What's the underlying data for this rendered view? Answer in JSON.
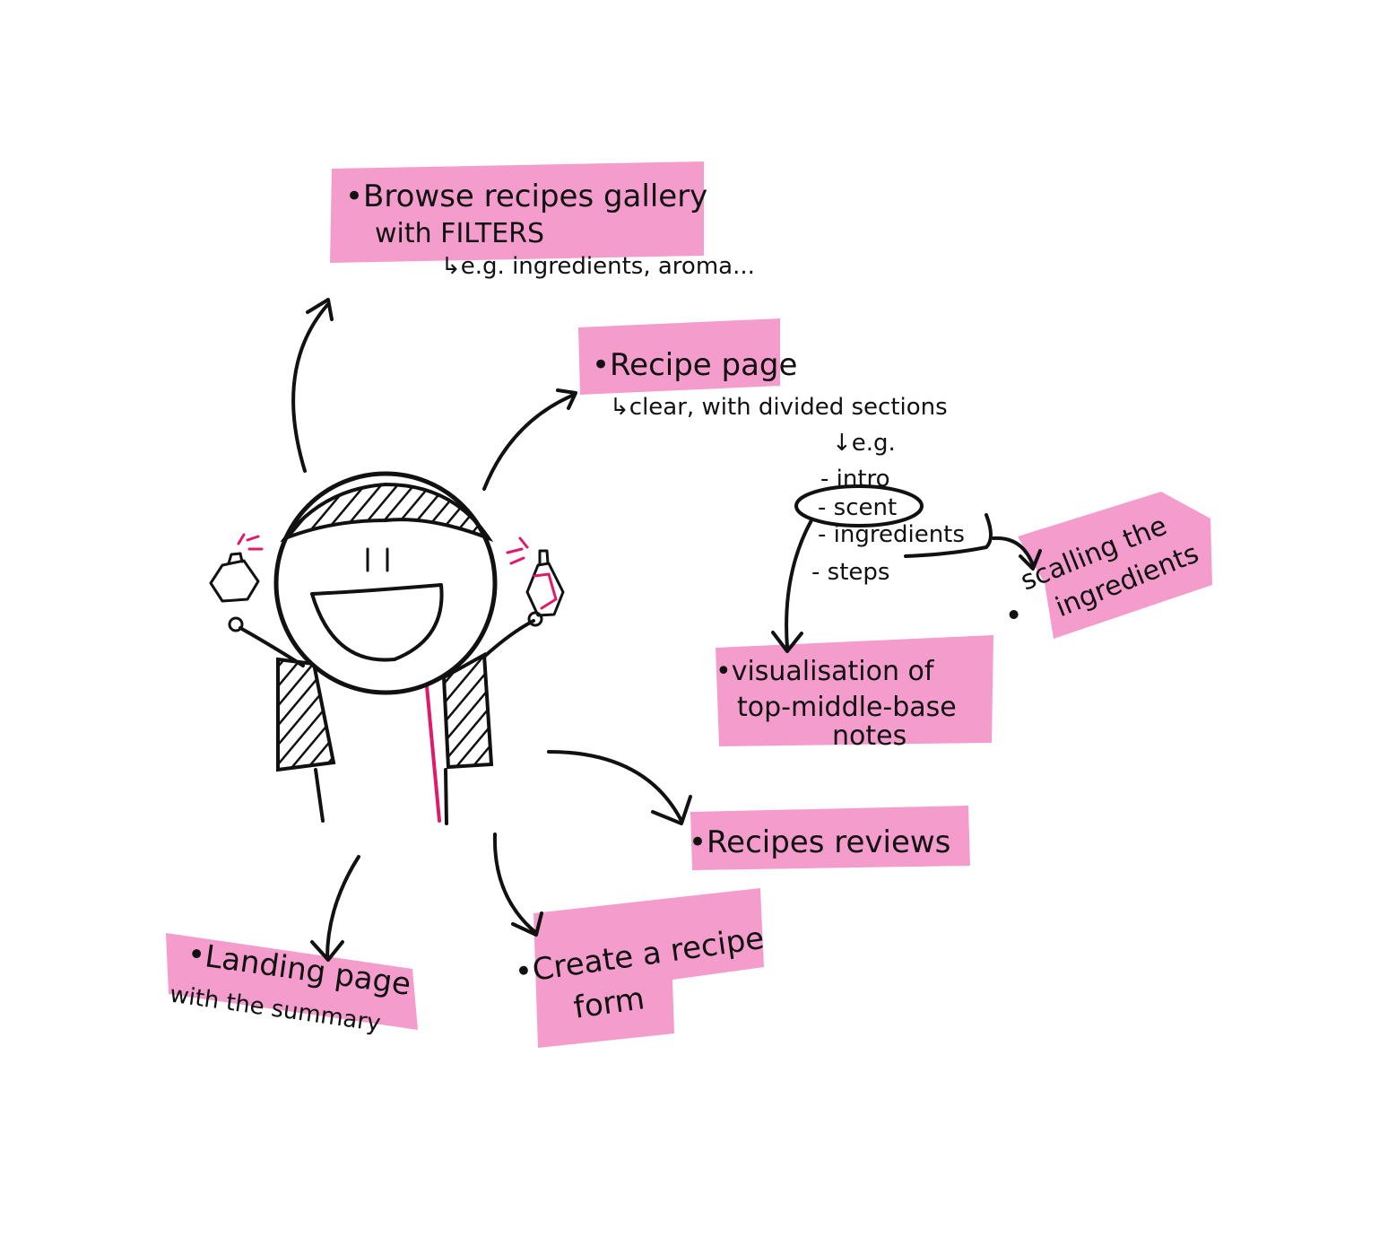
{
  "nodes": {
    "browse": {
      "line1": "•Browse recipes gallery",
      "line2": "with FILTERS",
      "note": "↳e.g. ingredients, aroma..."
    },
    "recipe_page": {
      "title": "•Recipe page",
      "note": "↳clear, with divided sections",
      "eg": "↓e.g.",
      "sections": [
        "- intro",
        "- scent",
        "- ingredients",
        "- steps"
      ]
    },
    "scaling": {
      "line1": "scalling the",
      "line2": "ingredients"
    },
    "visualisation": {
      "line1": "•visualisation of",
      "line2": "top-middle-base",
      "line3": "notes"
    },
    "reviews": {
      "title": "•Recipes reviews"
    },
    "create": {
      "line1": "•Create a recipe",
      "line2": "form"
    },
    "landing": {
      "title": "•Landing page",
      "note": "with the summary"
    }
  },
  "colors": {
    "highlight": "#f49ccc",
    "ink": "#111111",
    "accent": "#e0196b"
  }
}
